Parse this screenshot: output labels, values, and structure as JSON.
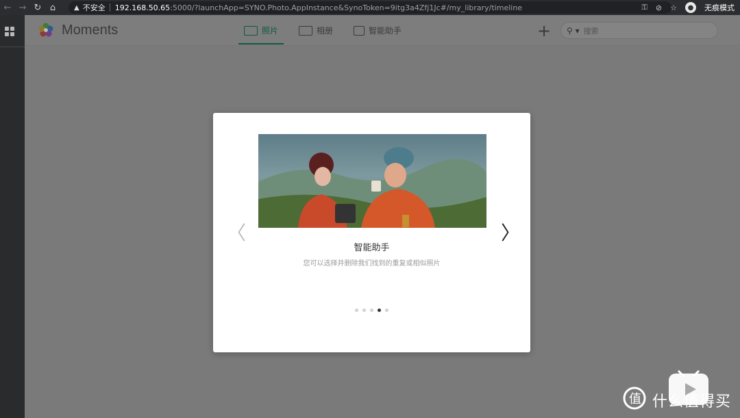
{
  "browser": {
    "back_icon": "←",
    "forward_icon": "→",
    "reload_icon": "↻",
    "home_icon": "⌂",
    "security_warning_icon": "▲",
    "insecure_label": "不安全",
    "url_host": "192.168.50.65",
    "url_path": ":5000/?launchApp=SYNO.Photo.AppInstance&SynoToken=9itg3a4Zfj1Jc#/my_library/timeline",
    "key_icon": "⚿",
    "eye_off_icon": "⊘",
    "star_icon": "☆",
    "incognito_label": "无痕模式"
  },
  "app": {
    "name": "Moments",
    "tabs": [
      {
        "label": "照片",
        "active": true
      },
      {
        "label": "相册",
        "active": false
      },
      {
        "label": "智能助手",
        "active": false
      }
    ],
    "add_icon": "+",
    "search_icon": "🔍",
    "search_placeholder": "搜索"
  },
  "modal": {
    "title": "智能助手",
    "description": "您可以选择并删除我们找到的重复或相似照片",
    "prev_icon": "〈",
    "next_icon": "〉",
    "slides_total": 5,
    "slide_current": 4
  },
  "watermark": {
    "text": "什么值得买"
  },
  "colors": {
    "accent": "#0d5a3c",
    "overlay": "#7a7a7a",
    "modal_bg": "#ffffff"
  }
}
